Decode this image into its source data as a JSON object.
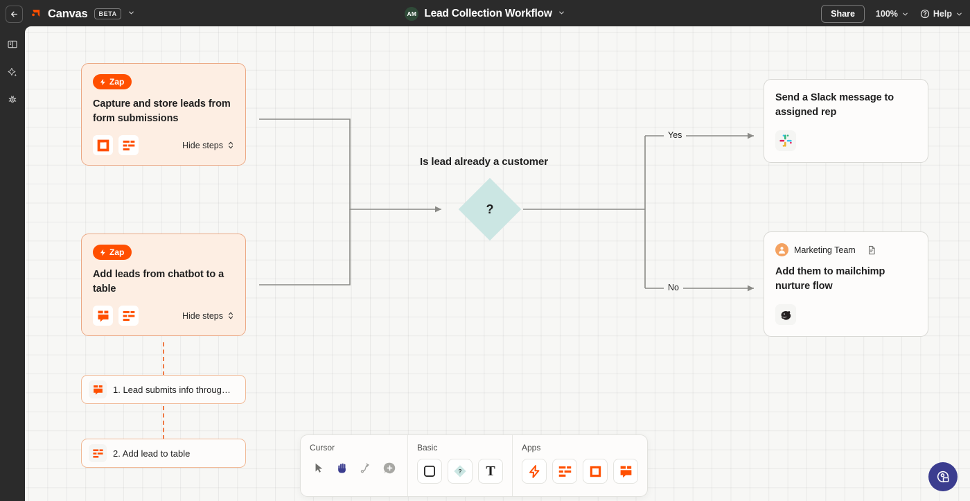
{
  "header": {
    "back_icon": "arrow-left-icon",
    "app_name": "Canvas",
    "beta_badge": "BETA",
    "app_chevron": "chevron-down-icon",
    "avatar_initials": "AM",
    "document_title": "Lead Collection Workflow",
    "title_chevron": "chevron-down-icon",
    "share_label": "Share",
    "zoom_level": "100%",
    "zoom_chevron": "chevron-down-icon",
    "help_label": "Help",
    "help_icon": "question-circle-icon",
    "help_chevron": "chevron-down-icon"
  },
  "sidebar": {
    "items": [
      {
        "name": "library-icon",
        "label": "Library"
      },
      {
        "name": "magic-sparkle-icon",
        "label": "AI"
      },
      {
        "name": "debug-bug-icon",
        "label": "Debug"
      }
    ]
  },
  "canvas": {
    "zap_cards": [
      {
        "badge": "Zap",
        "badge_icon": "bolt-icon",
        "title": "Capture and store leads from form submissions",
        "apps": [
          "typeform-square-icon",
          "tables-icon"
        ],
        "toggle_label": "Hide steps",
        "toggle_icon": "chevron-updown-icon"
      },
      {
        "badge": "Zap",
        "badge_icon": "bolt-icon",
        "title": "Add leads from chatbot to a table",
        "apps": [
          "chatbot-icon",
          "tables-icon"
        ],
        "toggle_label": "Hide steps",
        "toggle_icon": "chevron-updown-icon"
      }
    ],
    "steps": [
      {
        "icon": "chatbot-icon",
        "label": "1. Lead submits info throug…"
      },
      {
        "icon": "tables-icon",
        "label": "2. Add lead to table"
      }
    ],
    "decision": {
      "label": "Is lead already a customer",
      "symbol": "?",
      "branches": [
        {
          "label": "Yes"
        },
        {
          "label": "No"
        }
      ]
    },
    "action_cards": [
      {
        "owner": null,
        "title": "Send a Slack message to assigned rep",
        "app_icon": "slack-icon"
      },
      {
        "owner": "Marketing Team",
        "owner_avatar": "person-avatar-icon",
        "owner_doc_icon": "document-icon",
        "title": "Add them to mailchimp nurture flow",
        "app_icon": "mailchimp-icon"
      }
    ]
  },
  "toolbar": {
    "groups": [
      {
        "label": "Cursor",
        "items": [
          {
            "name": "pointer-tool-icon"
          },
          {
            "name": "hand-tool-icon"
          },
          {
            "name": "connector-tool-icon"
          },
          {
            "name": "comment-tool-icon"
          }
        ]
      },
      {
        "label": "Basic",
        "items": [
          {
            "name": "rectangle-shape-icon"
          },
          {
            "name": "diamond-decision-icon",
            "glyph": "?"
          },
          {
            "name": "text-tool-icon",
            "glyph": "T"
          }
        ]
      },
      {
        "label": "Apps",
        "items": [
          {
            "name": "zap-bolt-icon"
          },
          {
            "name": "tables-icon"
          },
          {
            "name": "typeform-square-icon"
          },
          {
            "name": "chatbot-icon"
          }
        ]
      }
    ]
  },
  "fab": {
    "name": "support-chat-icon"
  },
  "colors": {
    "brand_orange": "#ff4f00",
    "zap_card_bg": "#fdeee3",
    "zap_card_border": "#eba884",
    "canvas_bg": "#f7f7f5",
    "header_bg": "#2b2b2b",
    "diamond_fill": "#cbe6e3",
    "fab_bg": "#3b3d8f",
    "edge_stroke": "#8a8a86"
  }
}
